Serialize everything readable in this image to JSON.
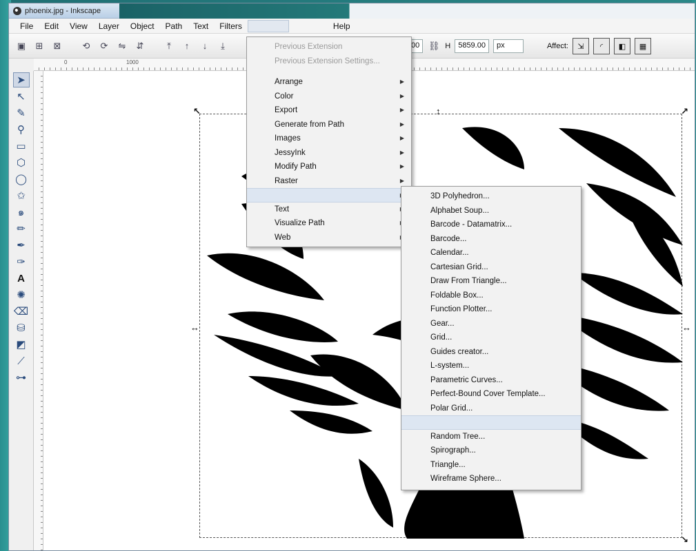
{
  "window": {
    "title": "phoenix.jpg - Inkscape"
  },
  "menubar": {
    "file": "File",
    "edit": "Edit",
    "view": "View",
    "layer": "Layer",
    "object": "Object",
    "path": "Path",
    "text": "Text",
    "filters": "Filters",
    "help": "Help"
  },
  "toolbar": {
    "w_value": "00",
    "h_label": "H",
    "h_value": "5859.00",
    "unit": "px",
    "affect_label": "Affect:"
  },
  "ruler": {
    "label1": "0",
    "label2": "1000"
  },
  "extensions_menu": {
    "previous_extension": "Previous Extension",
    "previous_extension_settings": "Previous Extension Settings...",
    "items": [
      "Arrange",
      "Color",
      "Export",
      "Generate from Path",
      "Images",
      "JessyInk",
      "Modify Path",
      "Raster"
    ],
    "items2": [
      "Text",
      "Visualize Path",
      "Web"
    ]
  },
  "render_submenu": {
    "items": [
      "3D Polyhedron...",
      "Alphabet Soup...",
      "Barcode - Datamatrix...",
      "Barcode...",
      "Calendar...",
      "Cartesian Grid...",
      "Draw From Triangle...",
      "Foldable Box...",
      "Function Plotter...",
      "Gear...",
      "Grid...",
      "Guides creator...",
      "L-system...",
      "Parametric Curves...",
      "Perfect-Bound Cover Template...",
      "Polar Grid..."
    ],
    "items2": [
      "Random Tree...",
      "Spirograph...",
      "Triangle...",
      "Wireframe Sphere..."
    ]
  },
  "colors": {
    "accent_highlight": "#dde6f2",
    "slide_bg": "#1f6f73"
  }
}
